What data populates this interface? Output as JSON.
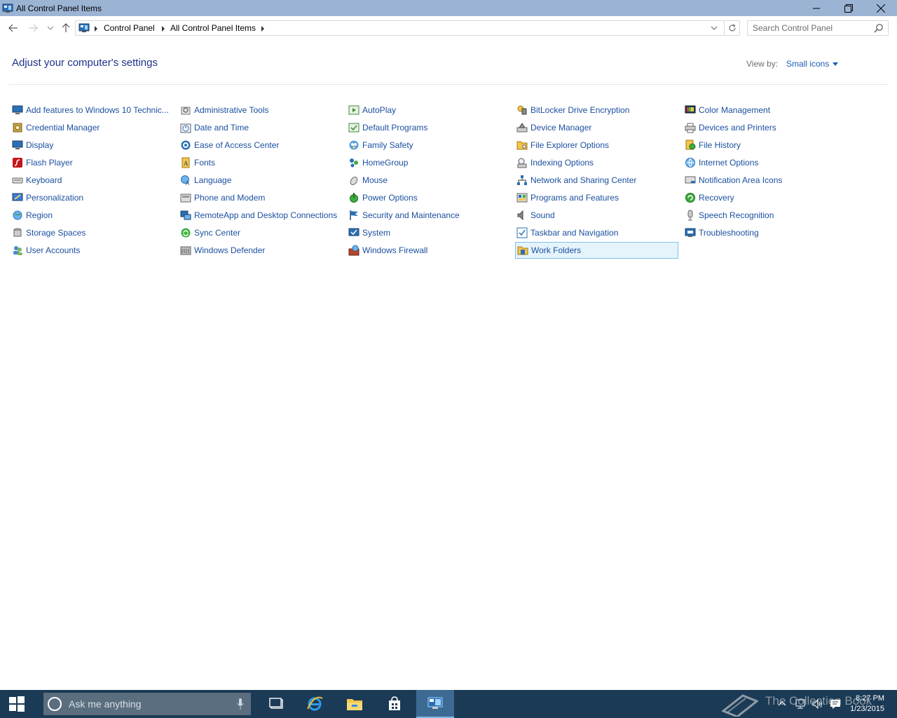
{
  "window": {
    "title": "All Control Panel Items"
  },
  "address_bar": {
    "crumbs": [
      "Control Panel",
      "All Control Panel Items"
    ]
  },
  "search": {
    "placeholder": "Search Control Panel"
  },
  "header": {
    "title": "Adjust your computer's settings",
    "view_by_label": "View by:",
    "view_by_value": "Small icons"
  },
  "items": [
    [
      "Add features to Windows 10 Technic...",
      "Credential Manager",
      "Display",
      "Flash Player",
      "Keyboard",
      "Personalization",
      "Region",
      "Storage Spaces",
      "User Accounts"
    ],
    [
      "Administrative Tools",
      "Date and Time",
      "Ease of Access Center",
      "Fonts",
      "Language",
      "Phone and Modem",
      "RemoteApp and Desktop Connections",
      "Sync Center",
      "Windows Defender"
    ],
    [
      "AutoPlay",
      "Default Programs",
      "Family Safety",
      "HomeGroup",
      "Mouse",
      "Power Options",
      "Security and Maintenance",
      "System",
      "Windows Firewall"
    ],
    [
      "BitLocker Drive Encryption",
      "Device Manager",
      "File Explorer Options",
      "Indexing Options",
      "Network and Sharing Center",
      "Programs and Features",
      "Sound",
      "Taskbar and Navigation",
      "Work Folders"
    ],
    [
      "Color Management",
      "Devices and Printers",
      "File History",
      "Internet Options",
      "Notification Area Icons",
      "Recovery",
      "Speech Recognition",
      "Troubleshooting"
    ]
  ],
  "selected_item": "Work Folders",
  "taskbar": {
    "cortana_placeholder": "Ask me anything",
    "clock_time": "8:27 PM",
    "clock_date": "1/23/2015",
    "watermark": "The Collection Book"
  },
  "colors": {
    "title_bar": "#9cb4d4",
    "link": "#1a4f9f",
    "heading": "#1e3287",
    "taskbar": "#1b3a55",
    "selection": "#e5f3fb"
  }
}
